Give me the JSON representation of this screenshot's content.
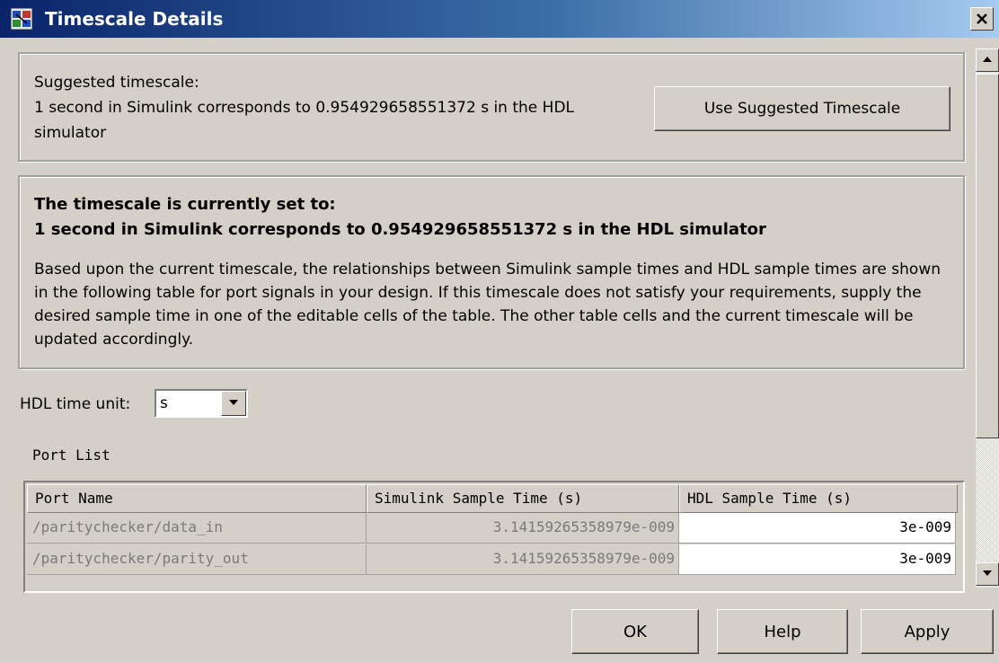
{
  "window": {
    "title": "Timescale Details",
    "icon": "simulink-app-icon"
  },
  "suggested": {
    "label": "Suggested timescale:",
    "line1": "1 second in Simulink corresponds to 0.954929658551372 s in the HDL",
    "line2": "simulator",
    "button": "Use Suggested Timescale"
  },
  "current": {
    "heading1": "The timescale is currently set to:",
    "heading2": "1 second in Simulink corresponds to 0.954929658551372 s in the HDL simulator",
    "description": "Based upon the current timescale, the relationships between Simulink sample times and HDL sample times are shown in the following table for port signals in your design. If this timescale does not satisfy your requirements, supply the desired sample time in one of the editable cells of the table. The other table cells and the current timescale will be updated accordingly."
  },
  "time_unit": {
    "label": "HDL time unit:",
    "value": "s"
  },
  "port_list": {
    "label": "Port List",
    "columns": [
      "Port Name",
      "Simulink Sample Time (s)",
      "HDL Sample Time (s)"
    ],
    "rows": [
      {
        "port": "/paritychecker/data_in",
        "simulink": "3.14159265358979e-009",
        "hdl": "3e-009"
      },
      {
        "port": "/paritychecker/parity_out",
        "simulink": "3.14159265358979e-009",
        "hdl": "3e-009"
      }
    ]
  },
  "buttons": {
    "ok": "OK",
    "help": "Help",
    "apply": "Apply"
  }
}
